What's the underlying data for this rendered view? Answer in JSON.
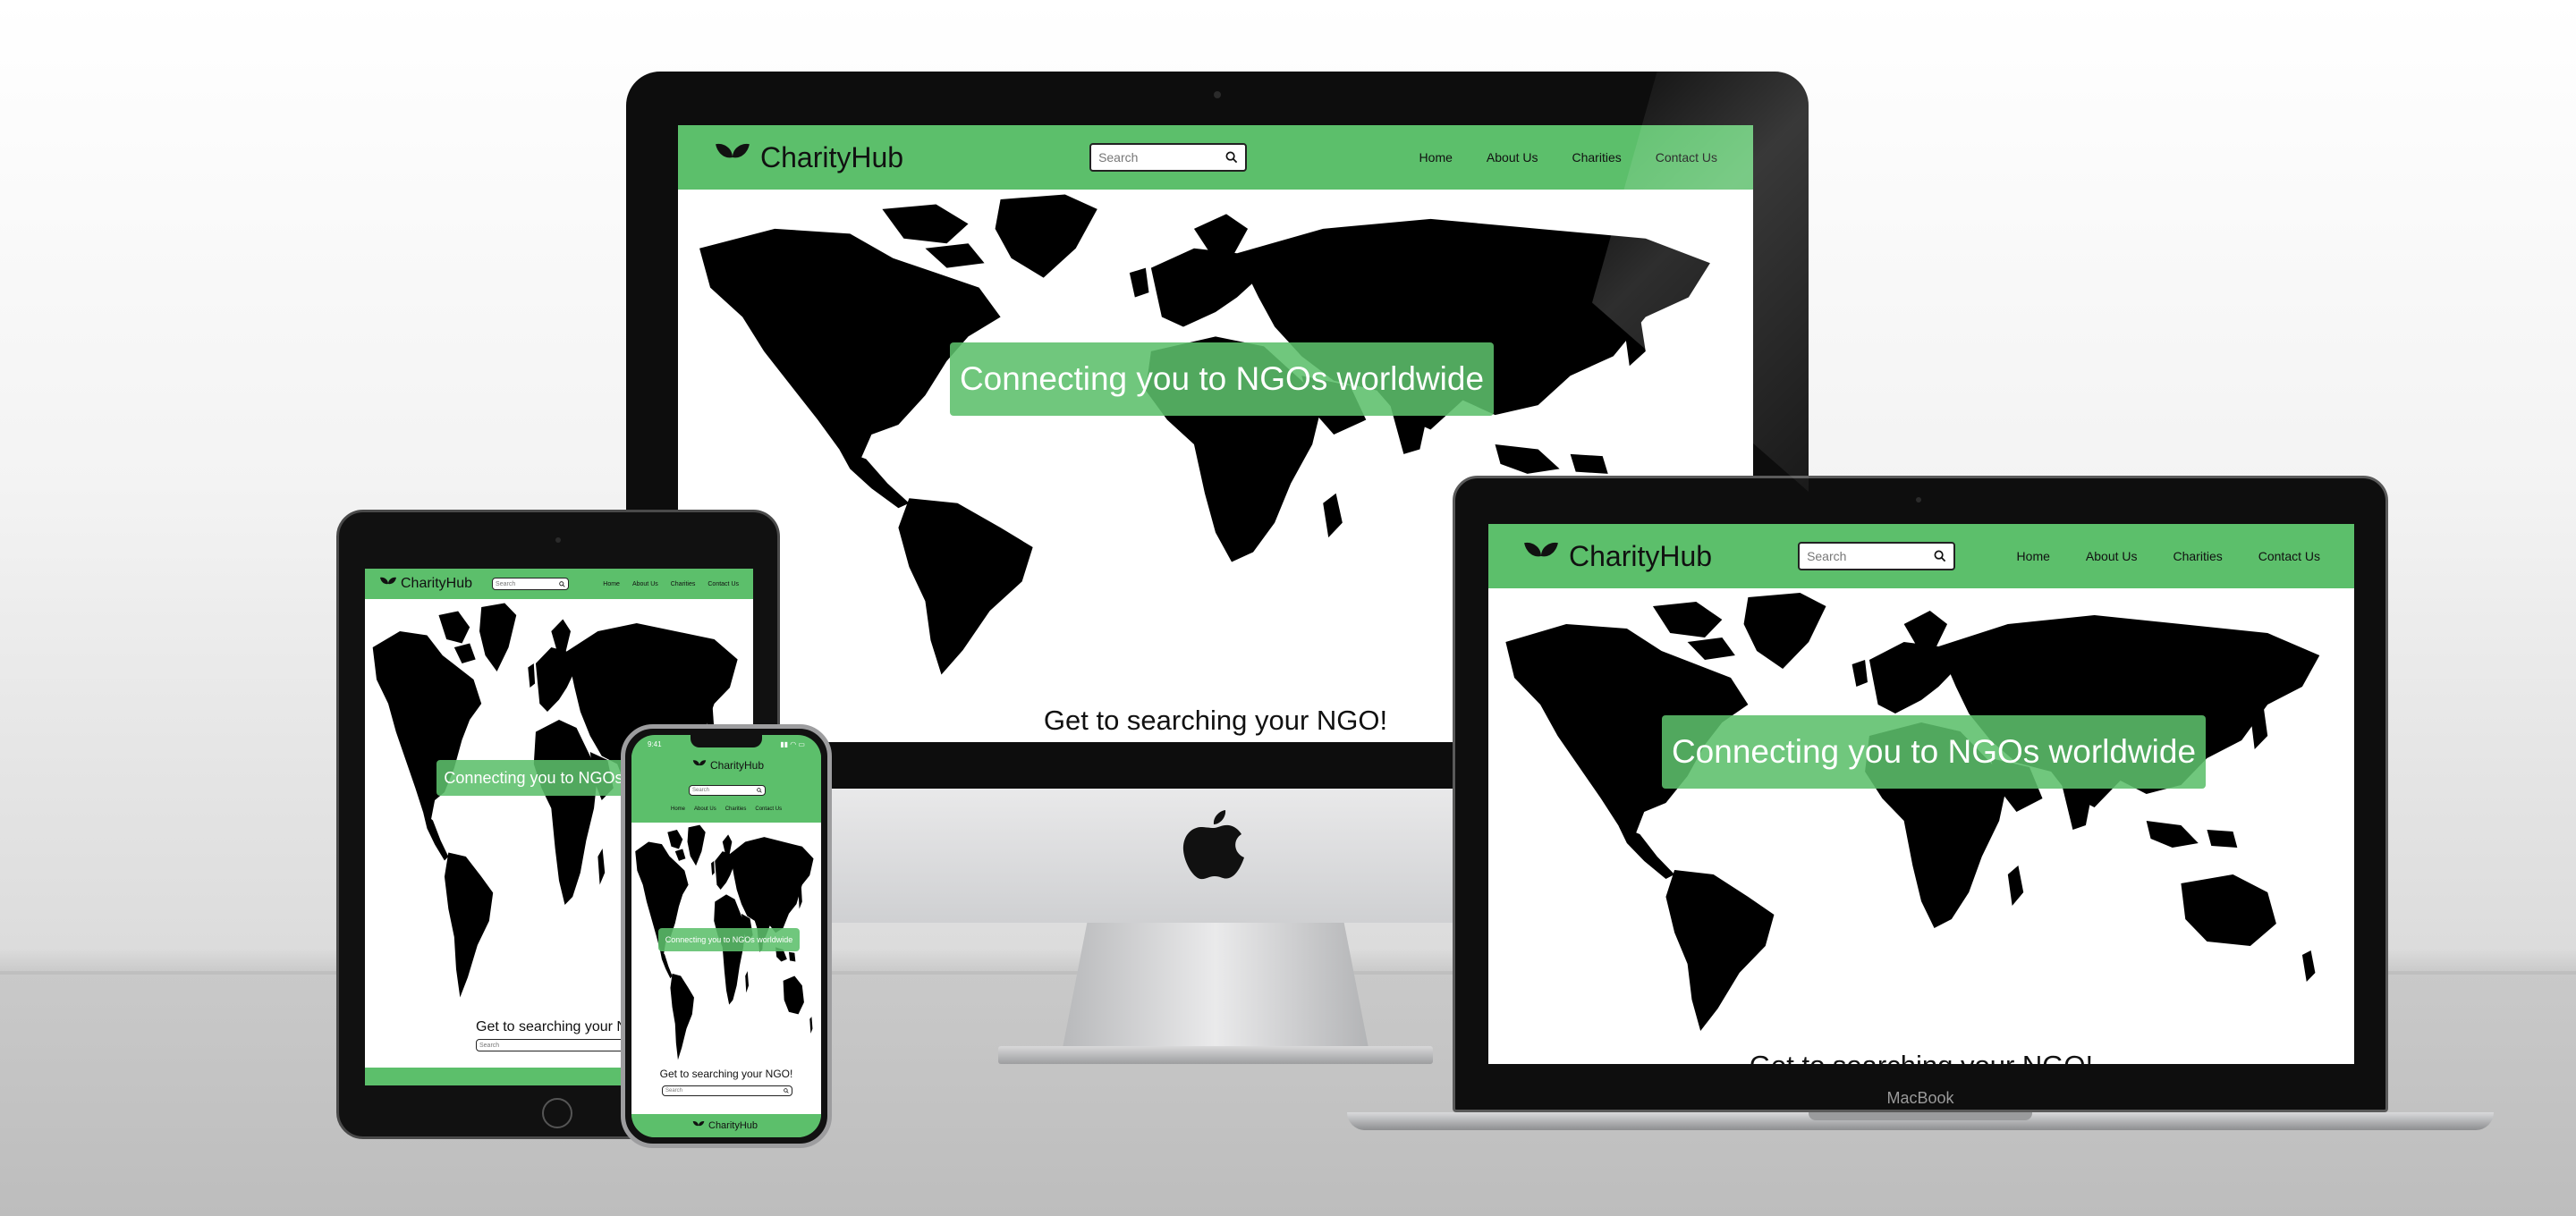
{
  "site": {
    "brand": "CharityHub",
    "search_placeholder": "Search",
    "nav_links": [
      "Home",
      "About Us",
      "Charities",
      "Contact Us"
    ],
    "banner": "Connecting you to NGOs worldwide",
    "cta": "Get to searching your NGO!",
    "cta_search_placeholder": "Search"
  },
  "devices": {
    "laptop_label": "MacBook",
    "phone_time": "9:41"
  },
  "colors": {
    "brand_green": "#5cbf6b",
    "map_land": "#000000",
    "map_sea": "#ffffff"
  }
}
